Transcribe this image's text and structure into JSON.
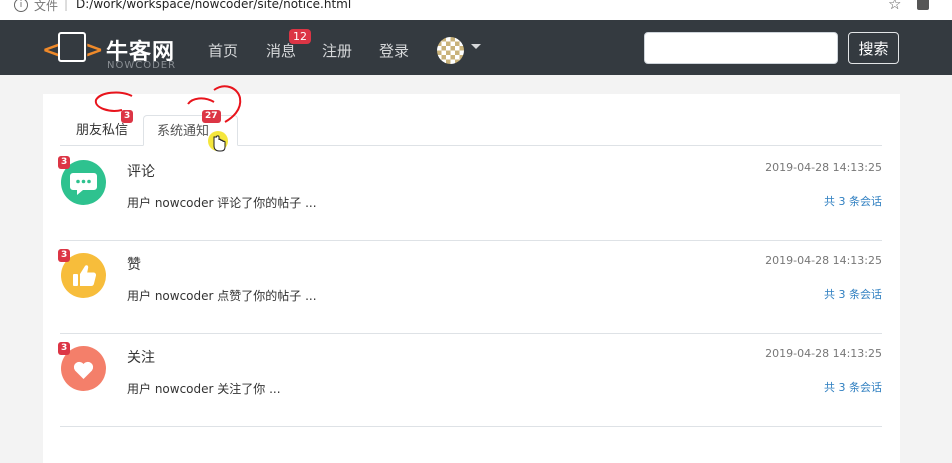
{
  "browser": {
    "file_label": "文件",
    "separator": "|",
    "url": "D:/work/workspace/nowcoder/site/notice.html"
  },
  "navbar": {
    "logo_name": "牛客网",
    "logo_sub": "NOWCODER",
    "items": [
      {
        "label": "首页"
      },
      {
        "label": "消息",
        "badge": "12"
      },
      {
        "label": "注册"
      },
      {
        "label": "登录"
      }
    ],
    "search": {
      "value": "",
      "button_label": "搜索"
    }
  },
  "tabs": [
    {
      "label": "朋友私信",
      "badge": "3",
      "active": false
    },
    {
      "label": "系统通知",
      "badge": "27",
      "active": true
    }
  ],
  "notices": [
    {
      "title": "评论",
      "badge": "3",
      "time": "2019-04-28 14:13:25",
      "message": "用户 nowcoder 评论了你的帖子 ...",
      "count": "共 3 条会话",
      "icon": "comment-icon",
      "color": "#2ec28f"
    },
    {
      "title": "赞",
      "badge": "3",
      "time": "2019-04-28 14:13:25",
      "message": "用户 nowcoder 点赞了你的帖子 ...",
      "count": "共 3 条会话",
      "icon": "thumbs-up-icon",
      "color": "#f7bd3b"
    },
    {
      "title": "关注",
      "badge": "3",
      "time": "2019-04-28 14:13:25",
      "message": "用户 nowcoder 关注了你 ...",
      "count": "共 3 条会话",
      "icon": "heart-icon",
      "color": "#f47f6a"
    }
  ],
  "colors": {
    "navbar": "#343a40",
    "badge": "#dc3545",
    "link": "#2f7fc1",
    "annotation": "#e8141c"
  }
}
